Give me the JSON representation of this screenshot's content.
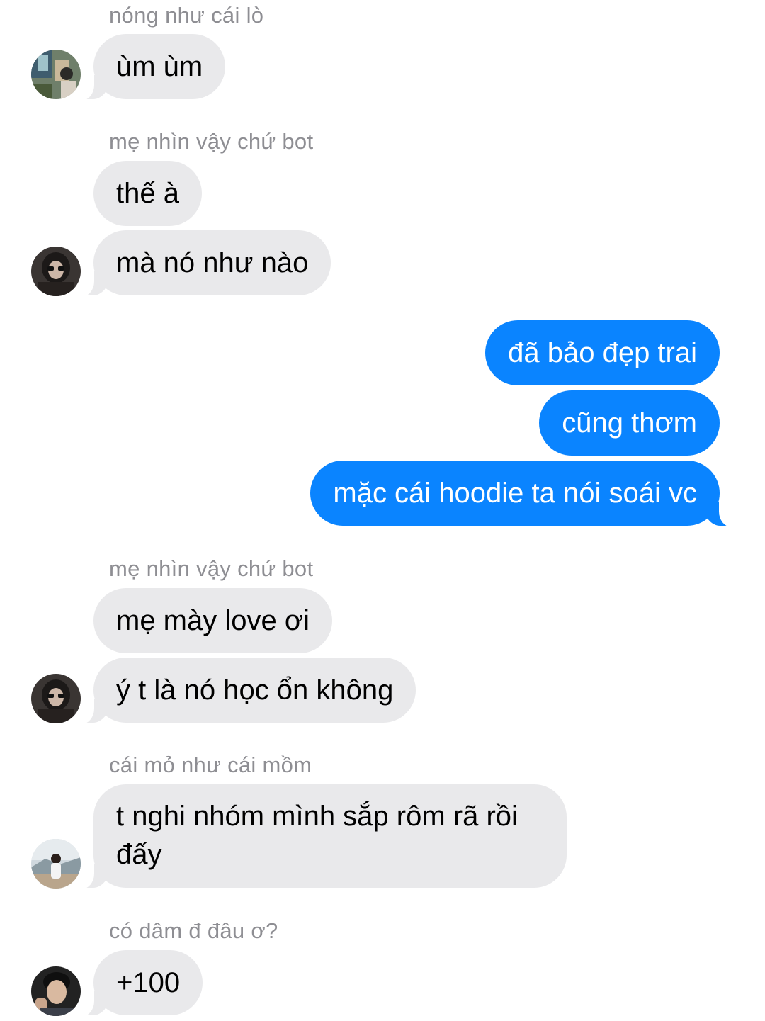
{
  "conversation": {
    "messages": [
      {
        "sender": "nóng như cái lò",
        "text": "ùm ùm",
        "direction": "incoming"
      },
      {
        "sender": "mẹ nhìn vậy chứ bot",
        "text": "thế à",
        "direction": "incoming"
      },
      {
        "text": "mà nó như nào",
        "direction": "incoming"
      },
      {
        "text": "đã bảo đẹp trai",
        "direction": "outgoing"
      },
      {
        "text": "cũng thơm",
        "direction": "outgoing"
      },
      {
        "text": "mặc cái hoodie ta nói soái vc",
        "direction": "outgoing"
      },
      {
        "sender": "mẹ nhìn vậy chứ bot",
        "text": "mẹ mày love ơi",
        "direction": "incoming"
      },
      {
        "text": "ý t là nó học ổn không",
        "direction": "incoming"
      },
      {
        "sender": "cái mỏ như cái mồm",
        "text": "t nghi nhóm mình sắp rôm rã rồi đấy",
        "direction": "incoming"
      },
      {
        "sender": "có dâm đ đâu ơ?",
        "text": "+100",
        "direction": "incoming"
      }
    ]
  },
  "colors": {
    "incoming_bubble": "#e9e9eb",
    "outgoing_bubble": "#0a84ff",
    "sender_label": "#8e8e93",
    "background": "#ffffff"
  },
  "icons": [
    "avatar-photo"
  ]
}
